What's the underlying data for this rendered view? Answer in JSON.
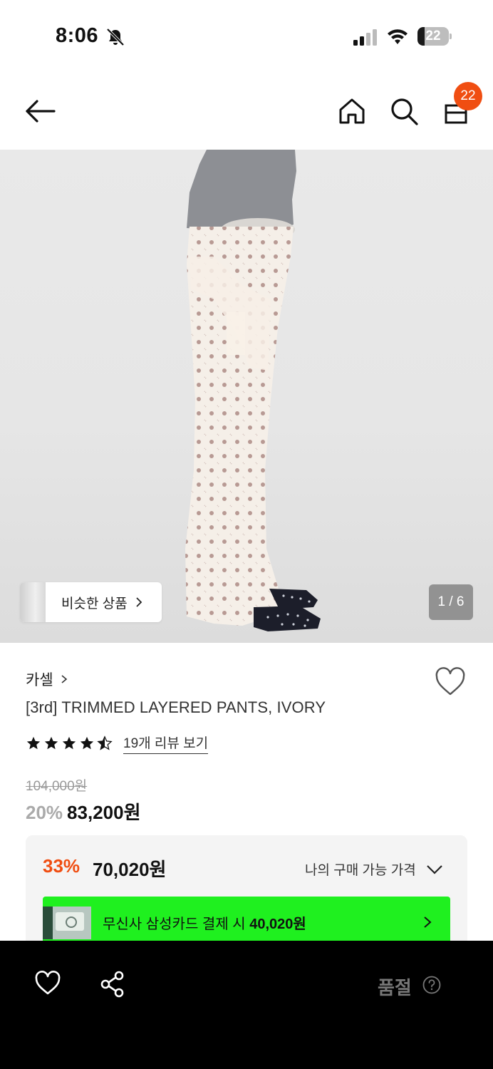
{
  "status_bar": {
    "time": "8:06",
    "battery_level": "22",
    "icons": [
      "bell-slash-icon",
      "cellular-signal-icon",
      "wifi-icon",
      "battery-icon"
    ]
  },
  "nav": {
    "cart_count": "22",
    "icons": [
      "back-arrow-icon",
      "home-icon",
      "search-icon",
      "shopping-bag-icon"
    ],
    "badge_color": "#f04e12"
  },
  "gallery": {
    "similar_label": "비슷한 상품",
    "page_indicator": "1 / 6"
  },
  "product": {
    "brand": "카셀",
    "title": "[3rd] TRIMMED LAYERED PANTS, IVORY",
    "rating_stars": 4.5,
    "review_link": "19개 리뷰 보기",
    "original_price": "104,000원",
    "discount_rate": "20%",
    "sale_price": "83,200원"
  },
  "best_price": {
    "rate": "33%",
    "price": "70,020원",
    "toggle_label": "나의 구매 가능 가격",
    "card_offer_prefix": "무신사 삼성카드 결제 시 ",
    "card_offer_price": "40,020원",
    "accent": "#f04e12",
    "banner_color": "#1ff01f"
  },
  "bottom_bar": {
    "status": "품절",
    "icons": [
      "heart-icon",
      "share-icon",
      "help-circle-icon"
    ]
  }
}
